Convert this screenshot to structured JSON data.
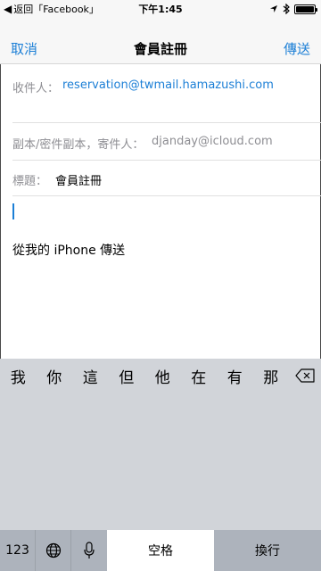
{
  "status_bar": {
    "back_label": "返回「Facebook」",
    "time": "下午1:45",
    "battery_level": 1.0
  },
  "nav": {
    "cancel_label": "取消",
    "title": "會員註冊",
    "send_label": "傳送"
  },
  "fields": {
    "to_label": "收件人：",
    "to_value": "reservation@twmail.hamazushi.com",
    "cc_label": "副本/密件副本，寄件人：",
    "cc_value": "djanday@icloud.com",
    "subject_label": "標題：",
    "subject_value": "會員註冊"
  },
  "body": {
    "signature": "從我的 iPhone 傳送"
  },
  "suggestions": [
    "我",
    "你",
    "這",
    "但",
    "他",
    "在",
    "有",
    "那"
  ],
  "keyboard": {
    "numbers_label": "123",
    "space_label": "空格",
    "return_label": "換行"
  },
  "icons": {
    "back": "chevron-left-icon",
    "location": "location-arrow-icon",
    "bluetooth": "bluetooth-icon",
    "battery": "battery-icon",
    "delete": "delete-backspace-icon",
    "globe": "globe-icon",
    "mic": "microphone-icon"
  },
  "colors": {
    "accent": "#1c7fd6",
    "label_gray": "#8e8e93",
    "keyboard_bg": "#d1d4d9",
    "function_key": "#adb3bc"
  }
}
